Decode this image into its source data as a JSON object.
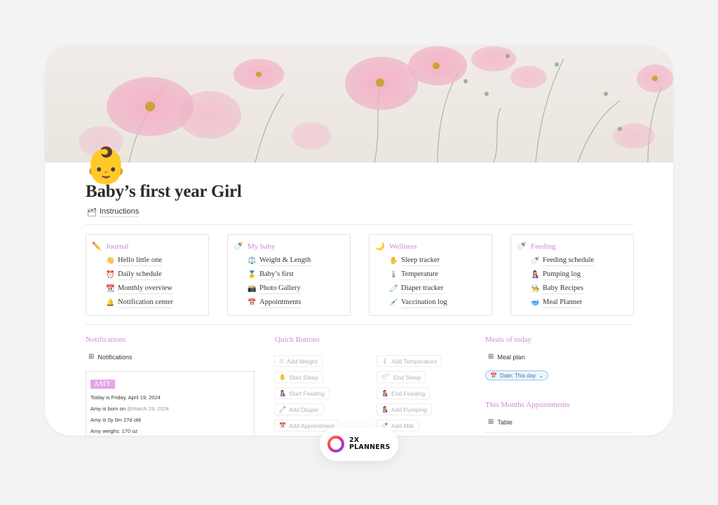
{
  "page": {
    "icon": "👶",
    "title": "Baby’s first year Girl",
    "instructions_icon": "🗂",
    "instructions_label": "Instructions"
  },
  "cards": [
    {
      "icon": "✏️",
      "title": "Journal",
      "items": [
        {
          "icon": "👋",
          "label": "Hello little one"
        },
        {
          "icon": "⏰",
          "label": "Daily schedule"
        },
        {
          "icon": "📆",
          "label": "Monthly overview"
        },
        {
          "icon": "🔔",
          "label": "Notification center"
        }
      ]
    },
    {
      "icon": "🍼",
      "title": "My baby",
      "items": [
        {
          "icon": "⚖️",
          "label": "Weight & Length"
        },
        {
          "icon": "🥇",
          "label": "Baby’s first"
        },
        {
          "icon": "📸",
          "label": "Photo Gallery"
        },
        {
          "icon": "📅",
          "label": "Appointments"
        }
      ]
    },
    {
      "icon": "🌙",
      "title": "Wellness",
      "items": [
        {
          "icon": "✋",
          "label": "Sleep tracker"
        },
        {
          "icon": "🌡",
          "label": "Temperature"
        },
        {
          "icon": "🧷",
          "label": "Diaper tracker"
        },
        {
          "icon": "💉",
          "label": "Vaccination log"
        }
      ]
    },
    {
      "icon": "🍼",
      "title": "Feeding",
      "items": [
        {
          "icon": "🍼",
          "label": "Feeding schedule"
        },
        {
          "icon": "🤱",
          "label": "Pumping log"
        },
        {
          "icon": "👨‍🍳",
          "label": "Baby Recipes"
        },
        {
          "icon": "🥣",
          "label": "Meal Planner"
        }
      ]
    }
  ],
  "notifications": {
    "heading": "Notifications",
    "view_icon": "⊞",
    "view_label": "Notifications",
    "tag": "AMY",
    "lines": [
      {
        "text": "Today is Friday, April 19, 2024",
        "muted": ""
      },
      {
        "text": "Amy is born on ",
        "muted": "@March 29, 2024"
      },
      {
        "text": "Amy is 0y 0m 27d old",
        "muted": ""
      },
      {
        "text": "Amy weighs: 170 oz",
        "muted": ""
      }
    ]
  },
  "quick_buttons": {
    "heading": "Quick Buttons",
    "left": [
      {
        "icon": "⚖",
        "label": "Add Weight"
      },
      {
        "icon": "✋",
        "label": "Start Sleep"
      },
      {
        "icon": "🤱",
        "label": "Start Feeding"
      },
      {
        "icon": "🧷",
        "label": "Add Diaper"
      },
      {
        "icon": "📅",
        "label": "Add Appointment"
      }
    ],
    "right": [
      {
        "icon": "🌡",
        "label": "Add Temperature"
      },
      {
        "icon": "😴",
        "label": "End Sleep"
      },
      {
        "icon": "🤱",
        "label": "End Feeding"
      },
      {
        "icon": "🤱",
        "label": "Add Pumping"
      },
      {
        "icon": "🍼",
        "label": "Add Milk"
      }
    ]
  },
  "meals": {
    "heading": "Meals of today",
    "view_icon": "⊞",
    "view_label": "Meal plan",
    "filter_icon": "📅",
    "filter_label": "Date: This day",
    "filter_chevron": "⌄"
  },
  "appointments": {
    "heading": "This Months Appointments",
    "view_icon": "⊞",
    "view_label": "Table"
  },
  "badge": {
    "line1": "2X",
    "line2": "PLANNERS"
  },
  "colors": {
    "accent_pink": "#d189d4",
    "tag_pink": "#e7a4e8",
    "filter_blue": "#3a78b8"
  }
}
